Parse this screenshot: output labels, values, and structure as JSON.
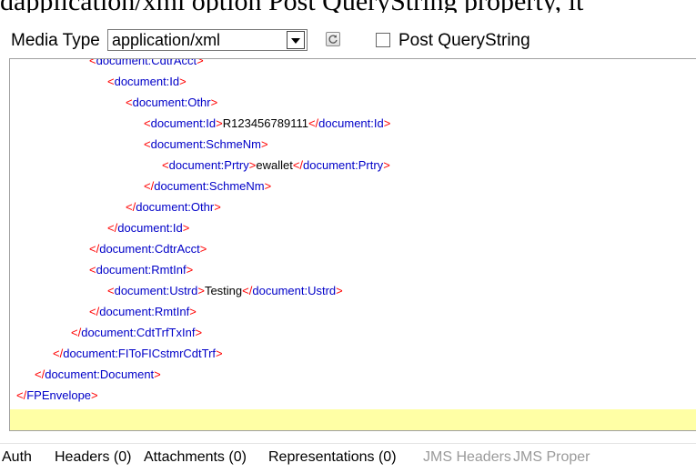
{
  "top_fragment": "dapplication/xml option Post QueryString property, it",
  "toolbar": {
    "media_type_label": "Media Type",
    "media_type_value": "application/xml",
    "post_querystring_label": "Post QueryString",
    "post_querystring_checked": false
  },
  "editor": {
    "lines": [
      {
        "indent": 0,
        "parts": [
          [
            "t",
            "<document:CdtrAcct>"
          ]
        ]
      },
      {
        "indent": 1,
        "parts": [
          [
            "t",
            "<document:Id>"
          ]
        ]
      },
      {
        "indent": 2,
        "parts": [
          [
            "t",
            "<document:Othr>"
          ]
        ]
      },
      {
        "indent": 3,
        "parts": [
          [
            "t",
            "<document:Id>"
          ],
          [
            "x",
            "R123456789111"
          ],
          [
            "t",
            "</document:Id>"
          ]
        ]
      },
      {
        "indent": 3,
        "parts": [
          [
            "t",
            "<document:SchmeNm>"
          ]
        ]
      },
      {
        "indent": 4,
        "parts": [
          [
            "t",
            "<document:Prtry>"
          ],
          [
            "x",
            "ewallet"
          ],
          [
            "t",
            "</document:Prtry>"
          ]
        ]
      },
      {
        "indent": 3,
        "parts": [
          [
            "t",
            "</document:SchmeNm>"
          ]
        ]
      },
      {
        "indent": 2,
        "parts": [
          [
            "t",
            "</document:Othr>"
          ]
        ]
      },
      {
        "indent": 1,
        "parts": [
          [
            "t",
            "</document:Id>"
          ]
        ]
      },
      {
        "indent": 0,
        "parts": [
          [
            "t",
            "</document:CdtrAcct>"
          ]
        ]
      },
      {
        "indent": 0,
        "parts": [
          [
            "t",
            "<document:RmtInf>"
          ]
        ]
      },
      {
        "indent": 1,
        "parts": [
          [
            "t",
            "<document:Ustrd>"
          ],
          [
            "x",
            "Testing"
          ],
          [
            "t",
            "</document:Ustrd>"
          ]
        ]
      },
      {
        "indent": 0,
        "parts": [
          [
            "t",
            "</document:RmtInf>"
          ]
        ]
      },
      {
        "indent": -1,
        "parts": [
          [
            "t",
            "</document:CdtTrfTxInf>"
          ]
        ]
      },
      {
        "indent": -2,
        "parts": [
          [
            "t",
            "</document:FIToFICstmrCdtTrf>"
          ]
        ]
      },
      {
        "indent": -3,
        "parts": [
          [
            "t",
            "</document:Document>"
          ]
        ]
      },
      {
        "indent": -4,
        "parts": [
          [
            "t",
            "</FPEnvelope>"
          ]
        ]
      },
      {
        "indent": 0,
        "parts": []
      }
    ]
  },
  "tabs": [
    {
      "label": "Auth",
      "state": "active"
    },
    {
      "label": "Headers (0)",
      "state": "active"
    },
    {
      "label": "Attachments (0)",
      "state": "active"
    },
    {
      "label": "Representations (0)",
      "state": "active"
    },
    {
      "label": "JMS Headers",
      "state": "disabled"
    },
    {
      "label": "JMS Proper",
      "state": "disabled"
    }
  ]
}
